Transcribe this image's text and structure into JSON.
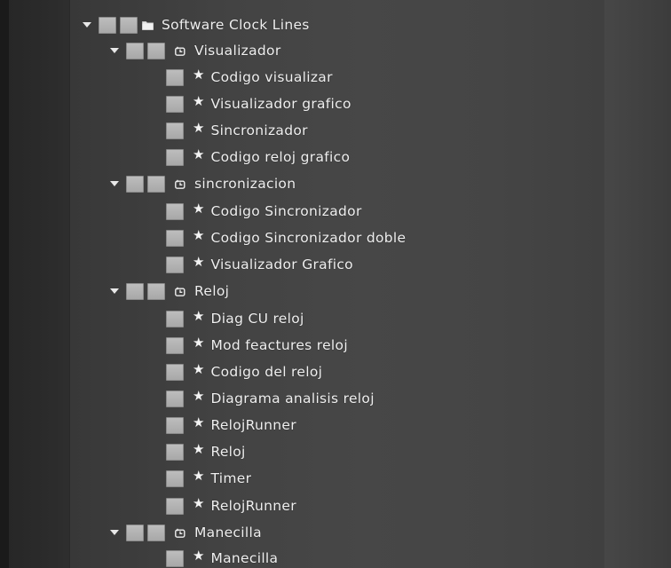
{
  "tree": {
    "root": {
      "label": "Software Clock Lines",
      "icon": "folder-icon"
    },
    "groups": [
      {
        "label": "Visualizador",
        "icon": "diagram-icon",
        "items": [
          "Codigo visualizar",
          "Visualizador grafico",
          "Sincronizador",
          "Codigo reloj grafico"
        ]
      },
      {
        "label": "sincronizacion",
        "icon": "diagram-icon",
        "items": [
          "Codigo Sincronizador",
          "Codigo Sincronizador doble",
          "Visualizador Grafico"
        ]
      },
      {
        "label": "Reloj",
        "icon": "diagram-icon",
        "items": [
          "Diag CU reloj",
          "Mod feactures reloj",
          "Codigo del reloj",
          "Diagrama analisis reloj",
          "RelojRunner",
          "Reloj",
          "Timer",
          "RelojRunner"
        ]
      },
      {
        "label": "Manecilla",
        "icon": "diagram-icon",
        "items": [
          "Manecilla"
        ]
      }
    ],
    "item_icon": "star-icon",
    "colors": {
      "text": "#f0f0f0",
      "checkbox": "#b4b4b4",
      "background": "#444444"
    }
  }
}
